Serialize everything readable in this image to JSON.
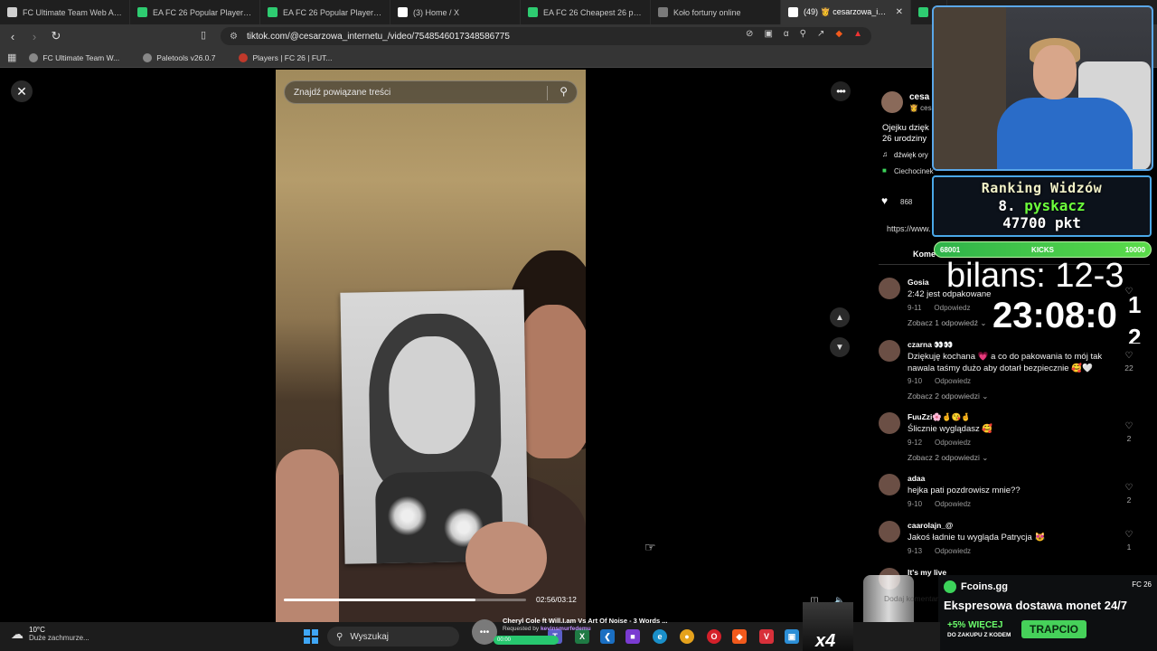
{
  "browser": {
    "tabs": [
      {
        "title": "FC Ultimate Team Web App - E",
        "icon": "ea-icon",
        "color": "#cfcfcf",
        "active": false
      },
      {
        "title": "EA FC 26 Popular Players | FUT",
        "icon": "futbin-icon",
        "color": "#2ecc71",
        "active": false
      },
      {
        "title": "EA FC 26 Popular Players | FUT",
        "icon": "futbin-icon",
        "color": "#2ecc71",
        "active": false
      },
      {
        "title": "(3) Home / X",
        "icon": "x-icon",
        "color": "#ffffff",
        "active": false
      },
      {
        "title": "EA FC 26 Cheapest 26 players",
        "icon": "futbin-icon",
        "color": "#2ecc71",
        "active": false
      },
      {
        "title": "Koło fortuny online",
        "icon": "wheel-icon",
        "color": "#7a7a7a",
        "active": false
      },
      {
        "title": "(49) 👸 cesarzowa_intern",
        "icon": "tiktok-icon",
        "color": "#ffffff",
        "active": true
      },
      {
        "title": "EA",
        "icon": "futbin-icon",
        "color": "#2ecc71",
        "active": false
      }
    ],
    "url": "tiktok.com/@cesarzowa_internetu_/video/7548546017348586775",
    "bookmarks": [
      {
        "label": "FC Ultimate Team W..."
      },
      {
        "label": "Paletools v26.0.7"
      },
      {
        "label": "Players | FC 26 | FUT..."
      }
    ]
  },
  "video": {
    "search_placeholder": "Znajdź powiązane treści",
    "progress": 0.79,
    "timecode": "02:56/03:12"
  },
  "panel": {
    "username": "cesa",
    "handle": "👸 ces",
    "caption_line1": "Ojejku dzięk",
    "caption_line2": "26 urodziny",
    "sound": "dźwięk ory",
    "tag": "Ciechocinek",
    "likes": "868",
    "share_url": "https://www.",
    "comments_tab": "Kome",
    "comments": [
      {
        "user": "Gosia",
        "text": "2:42 jest odpakowane",
        "date": "9-11",
        "reply": "Odpowiedz",
        "replies": "Zobacz 1 odpowiedź",
        "likes": ""
      },
      {
        "user": "czarna 👀👀",
        "text": "Dziękuję kochana 💗 a co do pakowania to mój tak nawala taśmy dużo aby dotarł bezpiecznie 🥰🤍",
        "date": "9-10",
        "reply": "Odpowiedz",
        "replies": "Zobacz 2 odpowiedzi",
        "likes": "22"
      },
      {
        "user": "FuuZzi🌸🤞😘🤞",
        "text": "Ślicznie wyglądasz 🥰",
        "date": "9-12",
        "reply": "Odpowiedz",
        "replies": "Zobacz 2 odpowiedzi",
        "likes": "2"
      },
      {
        "user": "adaa",
        "text": "hejka pati pozdrowisz mnie??",
        "date": "9-10",
        "reply": "Odpowiedz",
        "replies": "",
        "likes": "2"
      },
      {
        "user": "caarolajn_@",
        "text": "Jakoś ładnie tu wygląda Patrycja 😻",
        "date": "9-13",
        "reply": "Odpowiedz",
        "replies": "",
        "likes": "1"
      },
      {
        "user": "It's my live",
        "text": "",
        "date": "",
        "reply": "",
        "replies": "",
        "likes": ""
      }
    ],
    "add_comment": "Dodaj komentarz"
  },
  "overlay": {
    "ranking_title": "Ranking Widzów",
    "ranking_place": "8.",
    "ranking_nick": "pyskacz",
    "ranking_points": "47700 pkt",
    "kicks_left": "68001",
    "kicks_label": "KICKS",
    "kicks_right": "10000",
    "bilans": "bilans: 12-3",
    "clock": "23:08:0",
    "clock_tail1": "1",
    "clock_tail2": "2",
    "fcoins_brand": "Fcoins.gg",
    "fcoins_right": "FC 26",
    "fcoins_headline": "Ekspresowa dostawa monet 24/7",
    "fcoins_promo": "+5% WIĘCEJ",
    "fcoins_promo_small": "DO ZAKUPU Z KODEM",
    "fcoins_cta": "TRAPCIO",
    "mini_badge": "x4"
  },
  "taskbar": {
    "temperature": "10°C",
    "weather_desc": "Duże zachmurze...",
    "search_label": "Wyszukaj",
    "song": "Cheryl Cole ft Will.I.am Vs Art Of Noise - 3 Words ...",
    "requested_by_prefix": "Requested by",
    "requested_by": "kevinsmurfedemu",
    "song_time": "00:00"
  }
}
